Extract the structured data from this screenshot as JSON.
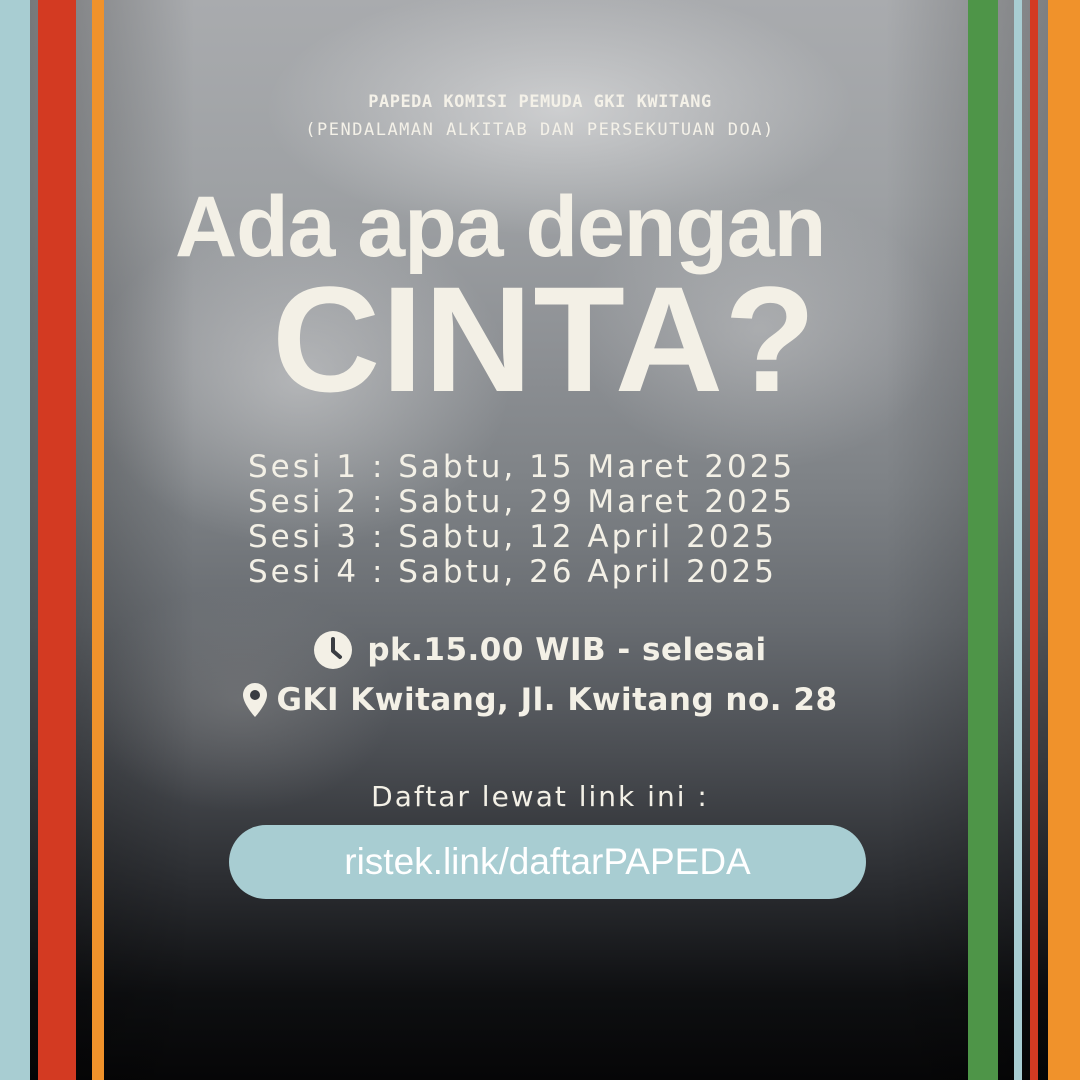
{
  "poster": {
    "organizer": "PAPEDA KOMISI PEMUDA GKI KWITANG",
    "organizer_expansion": "(PENDALAMAN ALKITAB DAN PERSEKUTUAN DOA)",
    "headline_line1": "Ada apa dengan",
    "headline_line2": "CINTA?",
    "sessions": [
      "Sesi 1 : Sabtu, 15 Maret 2025",
      "Sesi 2 : Sabtu, 29 Maret 2025",
      "Sesi 3 : Sabtu, 12 April 2025",
      "Sesi 4 : Sabtu, 26 April 2025"
    ],
    "time": "pk.15.00 WIB - selesai",
    "location": "GKI Kwitang, Jl. Kwitang no. 28",
    "register_label": "Daftar lewat link ini :",
    "register_link": "ristek.link/daftarPAPEDA"
  },
  "icons": {
    "time": "clock-icon",
    "location": "map-pin-icon"
  },
  "colors": {
    "light_blue": "#a8cdd2",
    "red": "#d33a22",
    "orange": "#f0922b",
    "green": "#4e9548",
    "text_cream": "#f3f0e6"
  }
}
